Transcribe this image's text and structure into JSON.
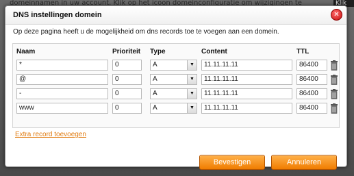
{
  "background": {
    "text": "domeinnamen in uw account. Klik op het icoon domeinconfiguratie om wijzigingen te",
    "chip": "Klik op"
  },
  "dialog": {
    "title": "DNS instellingen domein",
    "intro": "Op deze pagina heeft u de mogelijkheid om dns records toe te voegen aan een domein."
  },
  "columns": {
    "naam": "Naam",
    "prioriteit": "Prioriteit",
    "type": "Type",
    "content": "Content",
    "ttl": "TTL"
  },
  "records": [
    {
      "naam": "*",
      "prioriteit": "0",
      "type": "A",
      "content": "11.11.11.11",
      "ttl": "86400"
    },
    {
      "naam": "@",
      "prioriteit": "0",
      "type": "A",
      "content": "11.11.11.11",
      "ttl": "86400"
    },
    {
      "naam": "-",
      "prioriteit": "0",
      "type": "A",
      "content": "11.11.11.11",
      "ttl": "86400"
    },
    {
      "naam": "www",
      "prioriteit": "0",
      "type": "A",
      "content": "11.11.11.11",
      "ttl": "86400"
    }
  ],
  "actions": {
    "add_record": "Extra record toevoegen",
    "confirm": "Bevestigen",
    "cancel": "Annuleren"
  },
  "icons": {
    "close": "close-icon",
    "delete": "trash-icon",
    "dropdown": "chevron-down-icon"
  },
  "colors": {
    "accent": "#f07c00",
    "link": "#e07b10",
    "close": "#c81010"
  }
}
